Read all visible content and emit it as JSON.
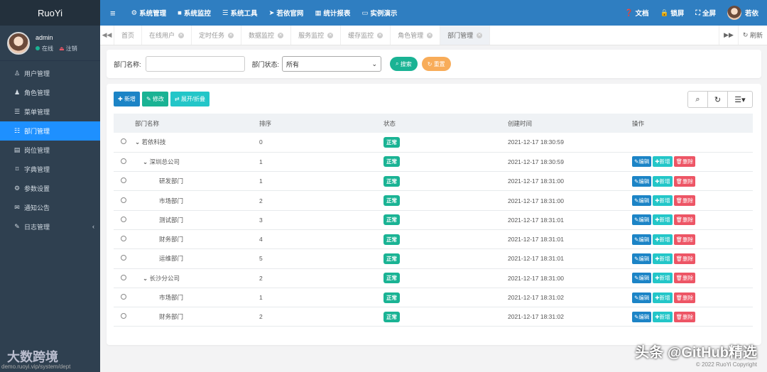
{
  "brand": "RuoYi",
  "user": {
    "name": "admin",
    "status": "在线",
    "logout": "注销"
  },
  "sidebar": {
    "items": [
      {
        "label": "用户管理",
        "icon": "user-icon",
        "glyph": "♙"
      },
      {
        "label": "角色管理",
        "icon": "role-icon",
        "glyph": "♟"
      },
      {
        "label": "菜单管理",
        "icon": "list-icon",
        "glyph": "☰"
      },
      {
        "label": "部门管理",
        "icon": "dept-icon",
        "glyph": "☷"
      },
      {
        "label": "岗位管理",
        "icon": "post-icon",
        "glyph": "▤"
      },
      {
        "label": "字典管理",
        "icon": "bookmark-icon",
        "glyph": "⌑"
      },
      {
        "label": "参数设置",
        "icon": "gear-icon",
        "glyph": "⚙"
      },
      {
        "label": "通知公告",
        "icon": "bullhorn-icon",
        "glyph": "✉"
      },
      {
        "label": "日志管理",
        "icon": "edit-icon",
        "glyph": "✎"
      }
    ]
  },
  "topbar": {
    "toggle": "≡",
    "items": [
      {
        "label": "系统管理",
        "glyph": "⚙"
      },
      {
        "label": "系统监控",
        "glyph": "■"
      },
      {
        "label": "系统工具",
        "glyph": "☰"
      },
      {
        "label": "若依官网",
        "glyph": "➤"
      },
      {
        "label": "统计报表",
        "glyph": "▦"
      },
      {
        "label": "实例演示",
        "glyph": "▭"
      }
    ],
    "right": {
      "doc": "文档",
      "lock": "锁屏",
      "full": "全屏",
      "user": "若依"
    }
  },
  "tabs": {
    "items": [
      {
        "label": "首页"
      },
      {
        "label": "在线用户"
      },
      {
        "label": "定时任务"
      },
      {
        "label": "数据监控"
      },
      {
        "label": "服务监控"
      },
      {
        "label": "缓存监控"
      },
      {
        "label": "角色管理"
      },
      {
        "label": "部门管理"
      }
    ],
    "refresh": "刷新"
  },
  "search": {
    "name_label": "部门名称:",
    "status_label": "部门状态:",
    "status_value": "所有",
    "search_btn": "搜索",
    "reset_btn": "重置"
  },
  "toolbar": {
    "add": "新增",
    "edit": "修改",
    "expand": "展开/折叠"
  },
  "table": {
    "headers": [
      "部门名称",
      "排序",
      "状态",
      "创建时间",
      "操作"
    ],
    "rows": [
      {
        "name": "若依科技",
        "order": "0",
        "status": "正常",
        "time": "2021-12-17 18:30:59",
        "level": 0,
        "caret": true,
        "ops": false
      },
      {
        "name": "深圳总公司",
        "order": "1",
        "status": "正常",
        "time": "2021-12-17 18:30:59",
        "level": 1,
        "caret": true,
        "ops": true
      },
      {
        "name": "研发部门",
        "order": "1",
        "status": "正常",
        "time": "2021-12-17 18:31:00",
        "level": 2,
        "caret": false,
        "ops": true
      },
      {
        "name": "市场部门",
        "order": "2",
        "status": "正常",
        "time": "2021-12-17 18:31:00",
        "level": 2,
        "caret": false,
        "ops": true
      },
      {
        "name": "测试部门",
        "order": "3",
        "status": "正常",
        "time": "2021-12-17 18:31:01",
        "level": 2,
        "caret": false,
        "ops": true
      },
      {
        "name": "财务部门",
        "order": "4",
        "status": "正常",
        "time": "2021-12-17 18:31:01",
        "level": 2,
        "caret": false,
        "ops": true
      },
      {
        "name": "运维部门",
        "order": "5",
        "status": "正常",
        "time": "2021-12-17 18:31:01",
        "level": 2,
        "caret": false,
        "ops": true
      },
      {
        "name": "长沙分公司",
        "order": "2",
        "status": "正常",
        "time": "2021-12-17 18:31:00",
        "level": 1,
        "caret": true,
        "ops": true
      },
      {
        "name": "市场部门",
        "order": "1",
        "status": "正常",
        "time": "2021-12-17 18:31:02",
        "level": 2,
        "caret": false,
        "ops": true
      },
      {
        "name": "财务部门",
        "order": "2",
        "status": "正常",
        "time": "2021-12-17 18:31:02",
        "level": 2,
        "caret": false,
        "ops": true
      }
    ],
    "op_labels": {
      "edit": "编辑",
      "add": "新增",
      "del": "删除"
    }
  },
  "colors": {
    "primary": "#1c84c6",
    "success": "#1ab394",
    "info": "#23c6c8",
    "warning": "#f8ac59",
    "danger": "#ed5565",
    "topbar": "#2f7ec1",
    "sidebar": "#2f4050",
    "active": "#1e90ff"
  },
  "overlay": {
    "watermark": "头条 @GitHub精选",
    "copyright": "© 2022 RuoYi Copyright",
    "url": "demo.ruoyi.vip/system/dept",
    "logo": "大数跨境"
  }
}
